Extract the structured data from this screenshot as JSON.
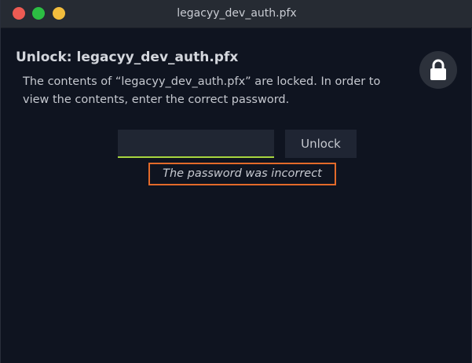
{
  "window": {
    "title": "legacyy_dev_auth.pfx"
  },
  "dialog": {
    "heading": "Unlock: legacyy_dev_auth.pfx",
    "message": "The contents of “legacyy_dev_auth.pfx” are locked. In order to view the contents, enter the correct password.",
    "lock_icon": "lock-icon",
    "password": {
      "value": "",
      "placeholder": ""
    },
    "unlock_label": "Unlock",
    "error": "The password was incorrect"
  },
  "colors": {
    "window_bg": "#0f1420",
    "titlebar_bg": "#262b33",
    "close": "#ed5b53",
    "minimize": "#2cbe43",
    "maximize": "#f2bd3d",
    "input_focus_underline": "#a8d63f",
    "error_highlight_border": "#e36a2a"
  }
}
